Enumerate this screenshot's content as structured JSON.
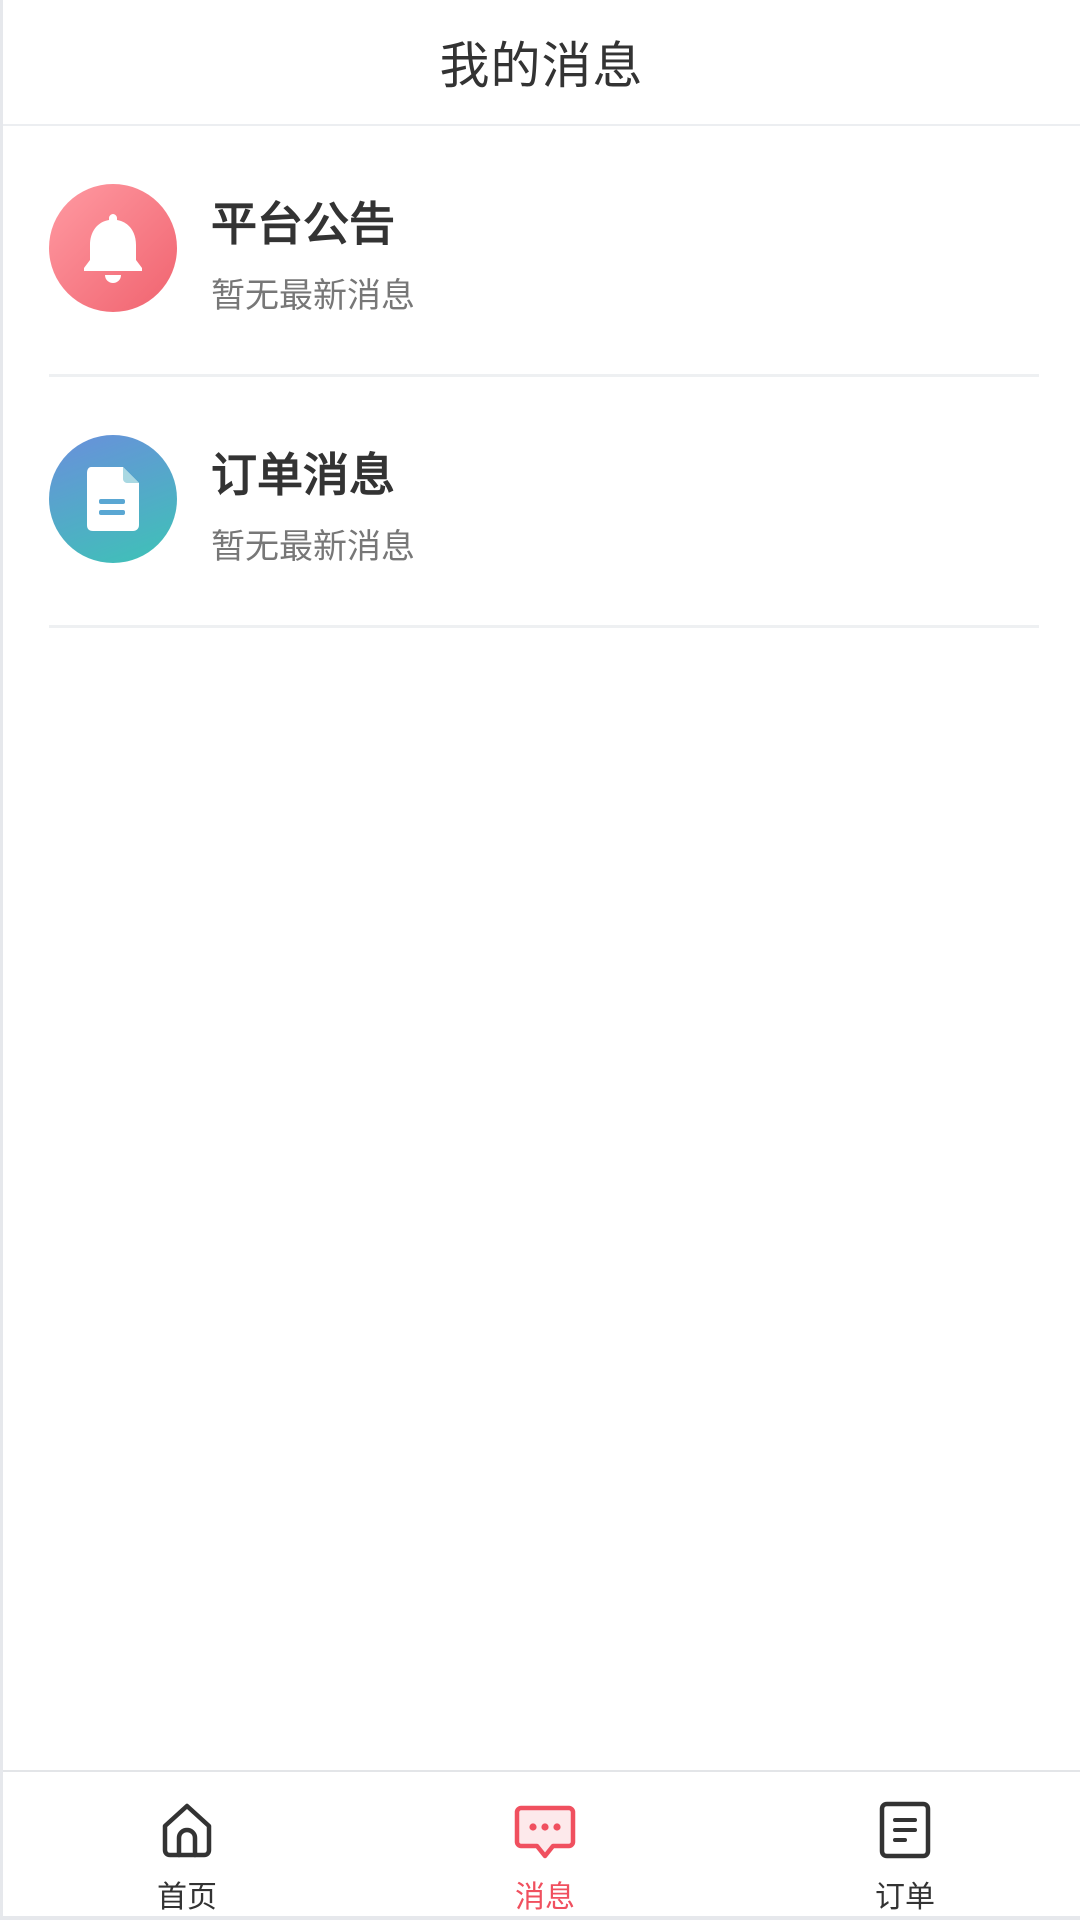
{
  "header": {
    "title": "我的消息"
  },
  "messages": [
    {
      "title": "平台公告",
      "subtitle": "暂无最新消息",
      "icon": "bell-icon",
      "color": "#f0636f"
    },
    {
      "title": "订单消息",
      "subtitle": "暂无最新消息",
      "icon": "document-icon",
      "color": "#4fa8c8"
    }
  ],
  "tabbar": {
    "items": [
      {
        "label": "首页",
        "icon": "home-icon",
        "active": false
      },
      {
        "label": "消息",
        "icon": "message-icon",
        "active": true
      },
      {
        "label": "订单",
        "icon": "order-icon",
        "active": false
      }
    ],
    "active_color": "#f0505f",
    "inactive_color": "#333333"
  }
}
